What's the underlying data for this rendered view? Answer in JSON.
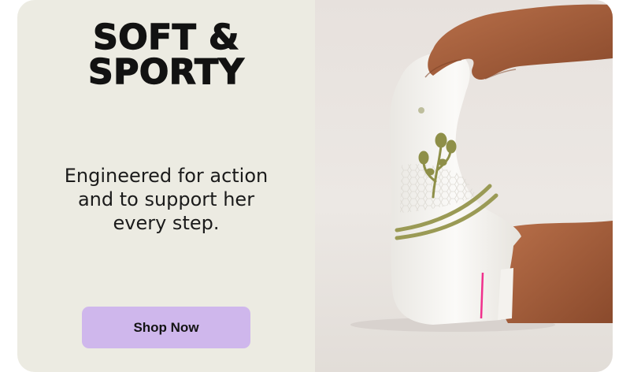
{
  "promo": {
    "headline_line1": "SOFT &",
    "headline_line2": "SPORTY",
    "subcopy_line1": "Engineered for action",
    "subcopy_line2": "and to support her",
    "subcopy_line3": "every step.",
    "cta_label": "Shop Now"
  },
  "colors": {
    "left_bg": "#ecebe2",
    "button_bg": "#cfb7ec",
    "text": "#121212",
    "sock_stripe": "#9a9a55",
    "sock_accent": "#f0308c"
  },
  "image": {
    "subject": "white-ankle-sock-on-foot-photo"
  }
}
